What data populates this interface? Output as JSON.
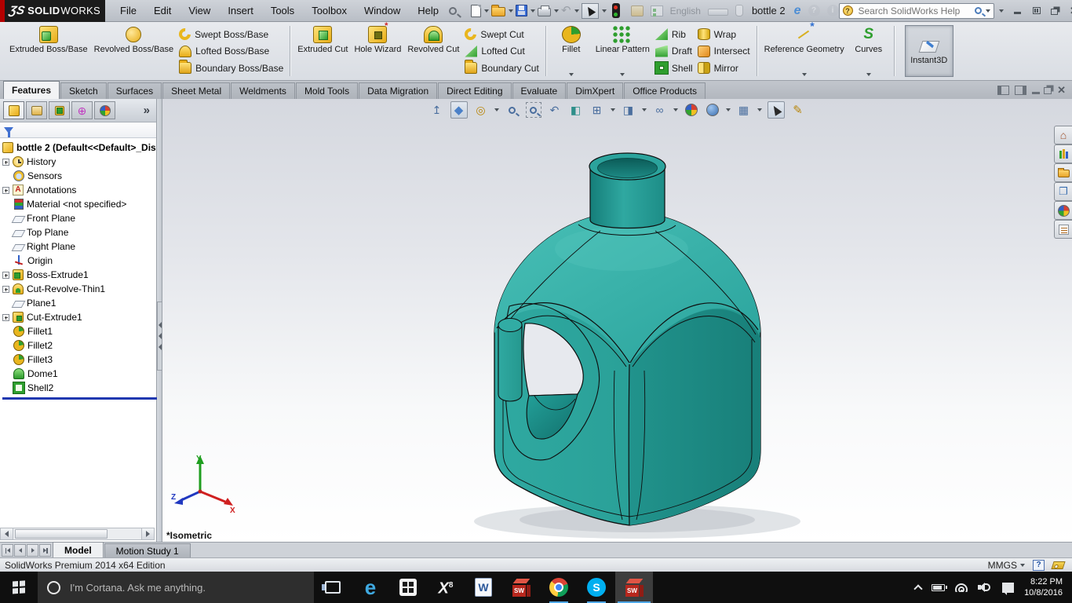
{
  "app": {
    "logo_mark": "ƷS",
    "logo_bold": "SOLID",
    "logo_light": "WORKS",
    "document_title": "bottle 2",
    "language": "English"
  },
  "titlebar": {
    "menus": [
      "File",
      "Edit",
      "View",
      "Insert",
      "Tools",
      "Toolbox",
      "Window",
      "Help"
    ],
    "help_search_placeholder": "Search SolidWorks Help"
  },
  "command_tabs": {
    "items": [
      "Features",
      "Sketch",
      "Surfaces",
      "Sheet Metal",
      "Weldments",
      "Mold Tools",
      "Data Migration",
      "Direct Editing",
      "Evaluate",
      "DimXpert",
      "Office Products"
    ],
    "active": "Features"
  },
  "ribbon": {
    "extruded_boss": "Extruded Boss/Base",
    "revolved_boss": "Revolved Boss/Base",
    "swept_boss": "Swept Boss/Base",
    "lofted_boss": "Lofted Boss/Base",
    "boundary_boss": "Boundary Boss/Base",
    "extruded_cut": "Extruded Cut",
    "hole_wizard": "Hole Wizard",
    "revolved_cut": "Revolved Cut",
    "swept_cut": "Swept Cut",
    "lofted_cut": "Lofted Cut",
    "boundary_cut": "Boundary Cut",
    "fillet": "Fillet",
    "linear_pattern": "Linear Pattern",
    "rib": "Rib",
    "draft": "Draft",
    "shell": "Shell",
    "wrap": "Wrap",
    "intersect": "Intersect",
    "mirror": "Mirror",
    "reference_geometry": "Reference Geometry",
    "curves": "Curves",
    "instant3d": "Instant3D"
  },
  "feature_tree": {
    "root": "bottle 2 (Default<<Default>_Dis",
    "items": [
      {
        "label": "History",
        "expandable": true
      },
      {
        "label": "Sensors",
        "expandable": false
      },
      {
        "label": "Annotations",
        "expandable": true
      },
      {
        "label": "Material <not specified>",
        "expandable": false
      },
      {
        "label": "Front Plane",
        "expandable": false
      },
      {
        "label": "Top Plane",
        "expandable": false
      },
      {
        "label": "Right Plane",
        "expandable": false
      },
      {
        "label": "Origin",
        "expandable": false
      },
      {
        "label": "Boss-Extrude1",
        "expandable": true
      },
      {
        "label": "Cut-Revolve-Thin1",
        "expandable": true
      },
      {
        "label": "Plane1",
        "expandable": false
      },
      {
        "label": "Cut-Extrude1",
        "expandable": true
      },
      {
        "label": "Fillet1",
        "expandable": false
      },
      {
        "label": "Fillet2",
        "expandable": false
      },
      {
        "label": "Fillet3",
        "expandable": false
      },
      {
        "label": "Dome1",
        "expandable": false
      },
      {
        "label": "Shell2",
        "expandable": false
      }
    ]
  },
  "viewport": {
    "view_label": "*Isometric",
    "axis_x": "X",
    "axis_y": "Y",
    "axis_z": "Z"
  },
  "doc_tabs": {
    "model": "Model",
    "motion_study": "Motion Study 1"
  },
  "statusbar": {
    "edition": "SolidWorks Premium 2014 x64 Edition",
    "units": "MMGS"
  },
  "taskbar": {
    "cortana_placeholder": "I'm Cortana. Ask me anything.",
    "time": "8:22 PM",
    "date": "10/8/2016"
  },
  "icons": {
    "edge": "e",
    "skype": "S",
    "word": "W",
    "xbox": "X",
    "xbox_sub": "8",
    "sw_letters": "SW",
    "question": "?",
    "info": "i",
    "chevron_more": "»",
    "home": "⌂",
    "view_palette": "❐",
    "undo": "↶",
    "prev_view": "↶",
    "plane_arrow": "↥",
    "cube": "◆",
    "measure": "◎",
    "section": "◧",
    "orientation": "⊞",
    "display_style": "◨",
    "hide_show": "∞",
    "view_settings": "▦",
    "sketch_pencil": "✎",
    "curves_glyph": "S"
  },
  "colors": {
    "model_teal": "#2aa49d",
    "model_teal_dark": "#1e938c",
    "model_teal_light": "#3db6ae",
    "rollback_bar": "#2038b0",
    "running_indicator": "#4fa8e8",
    "taskbar_bg": "#0f0f0f",
    "titlebar_logo_bg": "#1b1b1b",
    "accent_red_stripe": "#b40000"
  }
}
